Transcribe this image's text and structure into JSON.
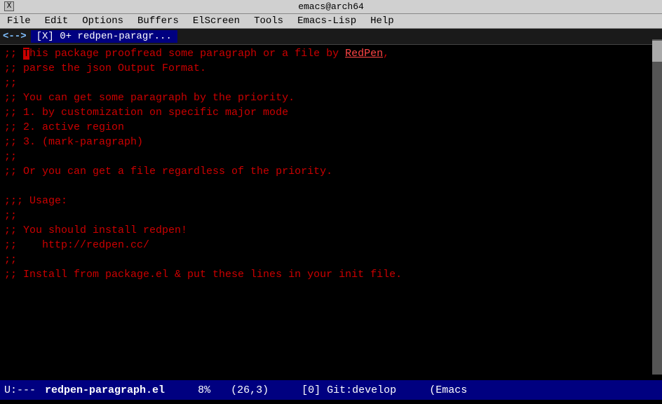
{
  "titlebar": {
    "title": "emacs@arch64",
    "close_label": "X"
  },
  "menubar": {
    "items": [
      "File",
      "Edit",
      "Options",
      "Buffers",
      "ElScreen",
      "Tools",
      "Emacs-Lisp",
      "Help"
    ]
  },
  "bufferbar": {
    "arrow": "<-->",
    "tab": "[X] 0+ redpen-paragr..."
  },
  "editor": {
    "lines": [
      ";; This package proofread some paragraph or a file by RedPen,",
      ";; parse the json Output Format.",
      ";;",
      ";; You can get some paragraph by the priority.",
      ";; 1. by customization on specific major mode",
      ";; 2. active region",
      ";; 3. (mark-paragraph)",
      ";;",
      ";; Or you can get a file regardless of the priority.",
      "",
      ";;; Usage:",
      ";;",
      ";; You should install redpen!",
      ";;    http://redpen.cc/",
      ";;",
      ";; Install from package.el & put these lines in your init file."
    ]
  },
  "statusbar": {
    "mode_left": "U:---",
    "filename": "redpen-paragraph.el",
    "percent": "8%",
    "position": "(26,3)",
    "git": "[0] Git:develop",
    "mode": "(Emacs"
  }
}
